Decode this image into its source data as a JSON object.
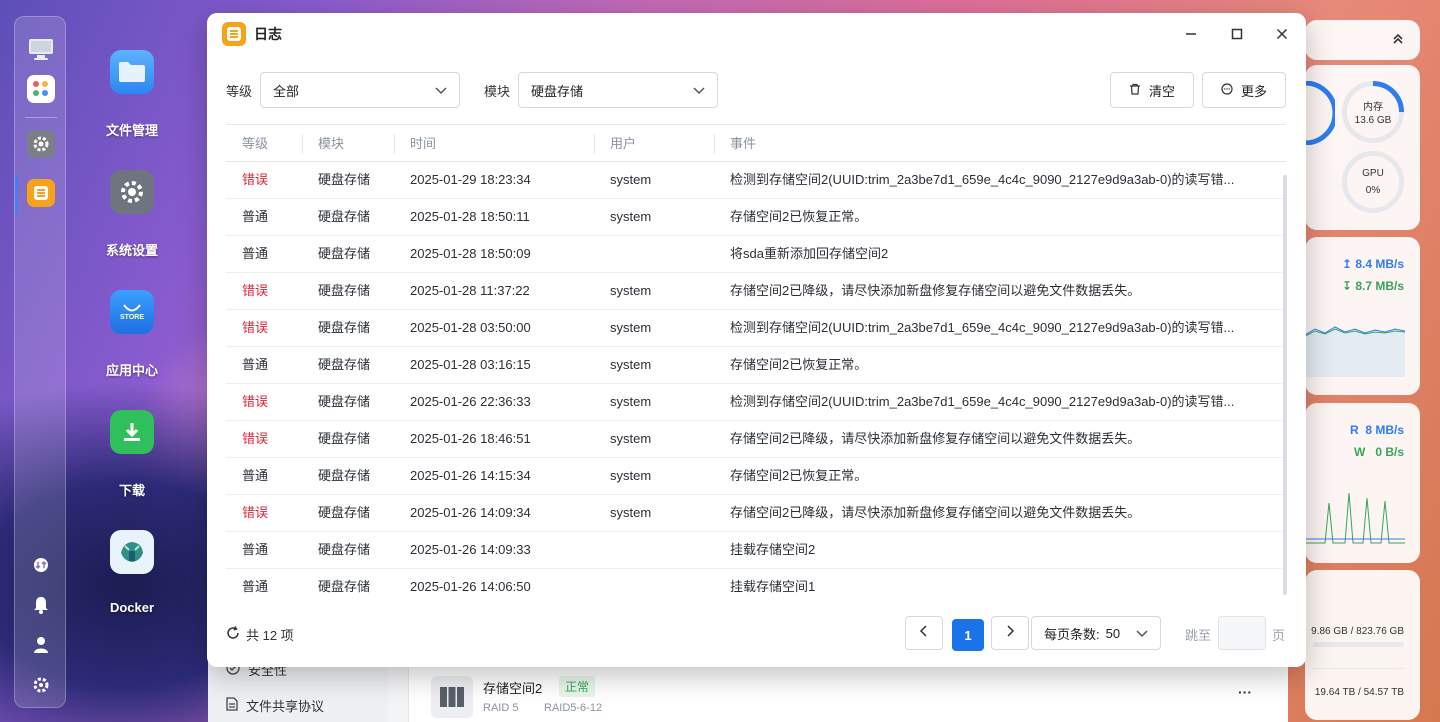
{
  "colors": {
    "accent": "#1a73e8",
    "error": "#e0243a",
    "success": "#3aa35c"
  },
  "desktop": {
    "icons": [
      {
        "label": "文件管理",
        "icon": "folder-icon"
      },
      {
        "label": "系统设置",
        "icon": "gear-icon"
      },
      {
        "label": "应用中心",
        "icon": "store-icon"
      },
      {
        "label": "下载",
        "icon": "download-icon"
      },
      {
        "label": "Docker",
        "icon": "docker-icon"
      }
    ],
    "store_text": "STORE"
  },
  "widgets": {
    "memory_label": "内存",
    "memory_value": "13.6 GB",
    "gpu_label": "GPU",
    "gpu_value": "0%",
    "net_up": "8.4 MB/s",
    "net_down": "8.7 MB/s",
    "disk_read_label": "R",
    "disk_read": "8 MB/s",
    "disk_write_label": "W",
    "disk_write": "0 B/s",
    "storage_used": "9.86 GB / 823.76 GB",
    "storage_total": "19.64 TB / 54.57 TB"
  },
  "background_window": {
    "sidebar_item_1": "安全性",
    "sidebar_item_2": "文件共享协议",
    "pool_name": "存储空间2",
    "pool_status": "正常",
    "pool_raid": "RAID 5",
    "pool_disks": "RAID5-6-12",
    "more": "···"
  },
  "dialog": {
    "title": "日志",
    "filter_level_label": "等级",
    "filter_level_value": "全部",
    "filter_module_label": "模块",
    "filter_module_value": "硬盘存储",
    "clear_label": "清空",
    "more_label": "更多",
    "columns": {
      "level": "等级",
      "module": "模块",
      "time": "时间",
      "user": "用户",
      "event": "事件"
    },
    "rows": [
      {
        "level": "错误",
        "module": "硬盘存储",
        "time": "2025-01-29 18:23:34",
        "user": "system",
        "event": "检测到存储空间2(UUID:trim_2a3be7d1_659e_4c4c_9090_2127e9d9a3ab-0)的读写错..."
      },
      {
        "level": "普通",
        "module": "硬盘存储",
        "time": "2025-01-28 18:50:11",
        "user": "system",
        "event": "存储空间2已恢复正常。"
      },
      {
        "level": "普通",
        "module": "硬盘存储",
        "time": "2025-01-28 18:50:09",
        "user": "",
        "event": "将sda重新添加回存储空间2"
      },
      {
        "level": "错误",
        "module": "硬盘存储",
        "time": "2025-01-28 11:37:22",
        "user": "system",
        "event": "存储空间2已降级，请尽快添加新盘修复存储空间以避免文件数据丢失。"
      },
      {
        "level": "错误",
        "module": "硬盘存储",
        "time": "2025-01-28 03:50:00",
        "user": "system",
        "event": "检测到存储空间2(UUID:trim_2a3be7d1_659e_4c4c_9090_2127e9d9a3ab-0)的读写错..."
      },
      {
        "level": "普通",
        "module": "硬盘存储",
        "time": "2025-01-28 03:16:15",
        "user": "system",
        "event": "存储空间2已恢复正常。"
      },
      {
        "level": "错误",
        "module": "硬盘存储",
        "time": "2025-01-26 22:36:33",
        "user": "system",
        "event": "检测到存储空间2(UUID:trim_2a3be7d1_659e_4c4c_9090_2127e9d9a3ab-0)的读写错..."
      },
      {
        "level": "错误",
        "module": "硬盘存储",
        "time": "2025-01-26 18:46:51",
        "user": "system",
        "event": "存储空间2已降级，请尽快添加新盘修复存储空间以避免文件数据丢失。"
      },
      {
        "level": "普通",
        "module": "硬盘存储",
        "time": "2025-01-26 14:15:34",
        "user": "system",
        "event": "存储空间2已恢复正常。"
      },
      {
        "level": "错误",
        "module": "硬盘存储",
        "time": "2025-01-26 14:09:34",
        "user": "system",
        "event": "存储空间2已降级，请尽快添加新盘修复存储空间以避免文件数据丢失。"
      },
      {
        "level": "普通",
        "module": "硬盘存储",
        "time": "2025-01-26 14:09:33",
        "user": "",
        "event": "挂载存储空间2"
      },
      {
        "level": "普通",
        "module": "硬盘存储",
        "time": "2025-01-26 14:06:50",
        "user": "",
        "event": "挂载存储空间1"
      }
    ],
    "total_label": "共 12 项",
    "current_page": "1",
    "page_size_label": "每页条数:",
    "page_size_value": "50",
    "goto_label": "跳至",
    "goto_value": "",
    "page_suffix": "页"
  }
}
